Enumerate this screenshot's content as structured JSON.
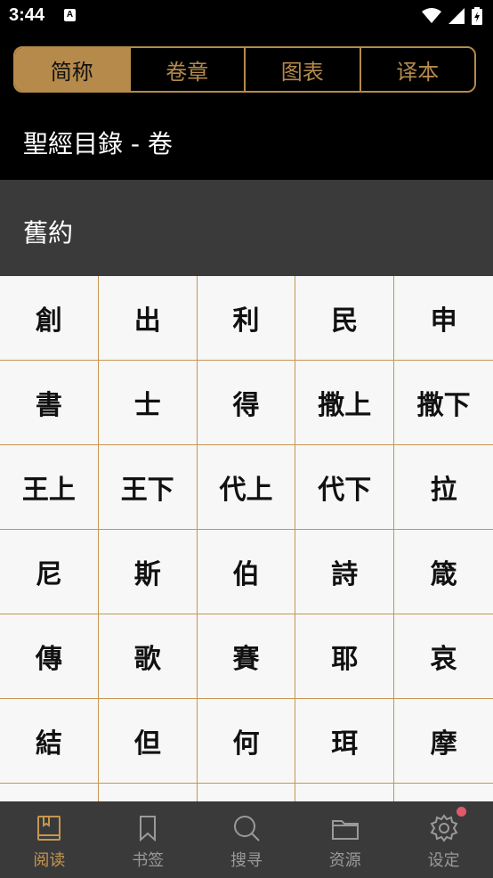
{
  "status": {
    "time": "3:44",
    "notification_glyph": "A"
  },
  "tabs": [
    {
      "label": "简称",
      "active": true
    },
    {
      "label": "卷章",
      "active": false
    },
    {
      "label": "图表",
      "active": false
    },
    {
      "label": "译本",
      "active": false
    }
  ],
  "page_title": "聖經目錄 - 卷",
  "section": {
    "label": "舊約"
  },
  "books": [
    [
      "創",
      "出",
      "利",
      "民",
      "申"
    ],
    [
      "書",
      "士",
      "得",
      "撒上",
      "撒下"
    ],
    [
      "王上",
      "王下",
      "代上",
      "代下",
      "拉"
    ],
    [
      "尼",
      "斯",
      "伯",
      "詩",
      "箴"
    ],
    [
      "傳",
      "歌",
      "賽",
      "耶",
      "哀"
    ],
    [
      "結",
      "但",
      "何",
      "珥",
      "摩"
    ],
    [
      "",
      "",
      "",
      "",
      ""
    ]
  ],
  "nav": [
    {
      "label": "阅读",
      "icon": "book-reading-icon",
      "active": true
    },
    {
      "label": "书签",
      "icon": "bookmark-icon",
      "active": false
    },
    {
      "label": "搜寻",
      "icon": "search-icon",
      "active": false
    },
    {
      "label": "资源",
      "icon": "folder-icon",
      "active": false
    },
    {
      "label": "设定",
      "icon": "gear-icon",
      "active": false,
      "badge": true
    }
  ],
  "colors": {
    "accent": "#b58a4a",
    "header_bg": "#3a3a3a",
    "grid_line": "#c6964f",
    "badge": "#e05a6a"
  }
}
